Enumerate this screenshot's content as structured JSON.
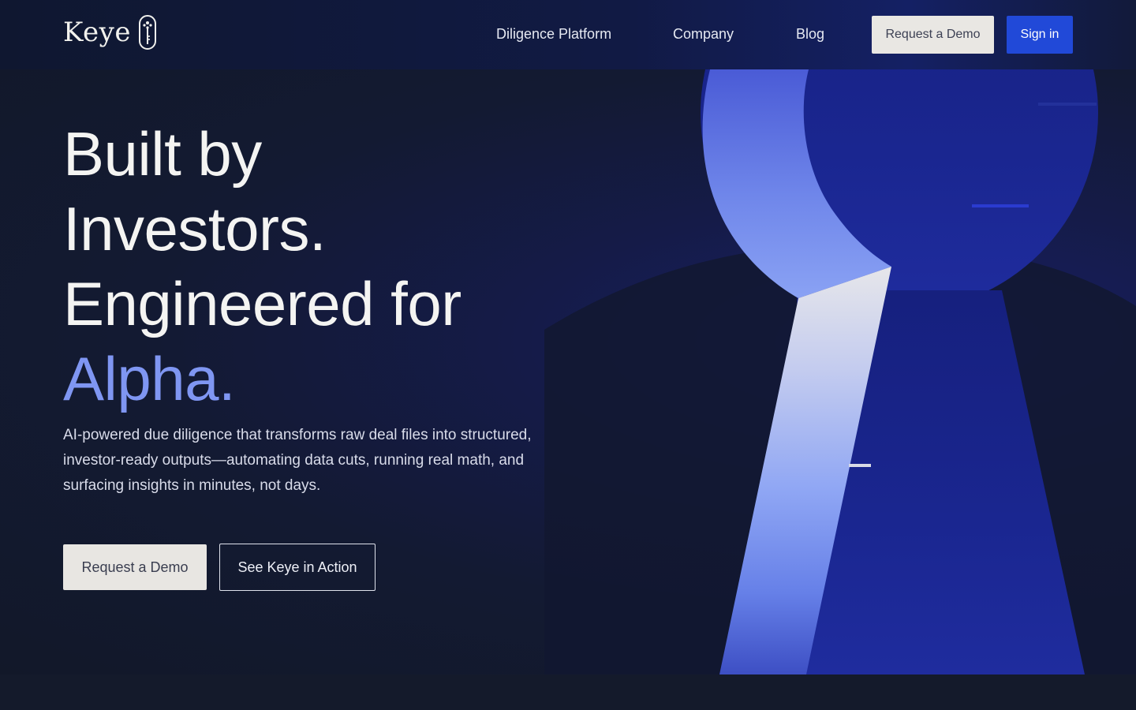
{
  "header": {
    "logo_text": "Keye",
    "nav": {
      "platform": "Diligence Platform",
      "company": "Company",
      "blog": "Blog"
    },
    "request_demo": "Request a Demo",
    "sign_in": "Sign in"
  },
  "hero": {
    "headline": {
      "line1": "Built by",
      "line2": "Investors.",
      "line3": "Engineered for",
      "accent": "Alpha."
    },
    "subtext": "AI-powered due diligence that transforms raw deal files into structured, investor-ready outputs—automating data cuts, running real math, and surfacing insights in minutes, not days.",
    "primary_cta": "Request a Demo",
    "secondary_cta": "See Keye in Action"
  },
  "colors": {
    "accent": "#7f96f2",
    "sign_in_button": "#2149d8",
    "background": "#131a2c"
  },
  "icons": {
    "logo": "key-icon"
  }
}
